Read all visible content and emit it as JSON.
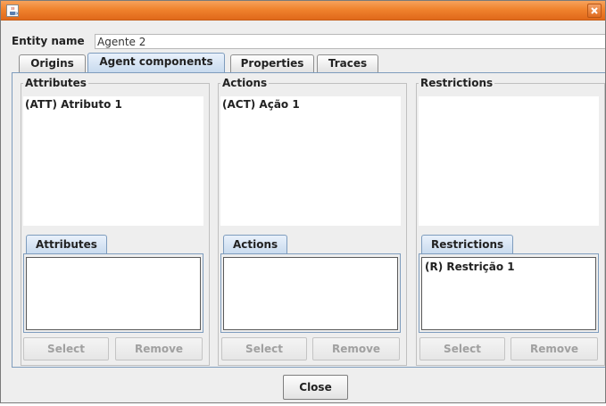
{
  "window": {
    "title": ""
  },
  "entity": {
    "label": "Entity name",
    "value": "Agente 2"
  },
  "tabs": [
    {
      "label": "Origins"
    },
    {
      "label": "Agent components"
    },
    {
      "label": "Properties"
    },
    {
      "label": "Traces"
    }
  ],
  "active_tab": "Agent components",
  "groups": [
    {
      "title": "Attributes",
      "items": [
        "(ATT) Atributo 1"
      ],
      "subtab": "Attributes",
      "sub_items": [
        ""
      ],
      "select_label": "Select",
      "remove_label": "Remove"
    },
    {
      "title": "Actions",
      "items": [
        "(ACT) Ação 1"
      ],
      "subtab": "Actions",
      "sub_items": [
        ""
      ],
      "select_label": "Select",
      "remove_label": "Remove"
    },
    {
      "title": "Restrictions",
      "items": [
        ""
      ],
      "subtab": "Restrictions",
      "sub_items": [
        "(R) Restrição 1"
      ],
      "select_label": "Select",
      "remove_label": "Remove"
    }
  ],
  "footer": {
    "close_label": "Close"
  },
  "colors": {
    "titlebar": "#f0832e",
    "accent_border": "#7e9cbd",
    "disabled_text": "#a0a0a0"
  },
  "icons": {
    "window_icon": "java-coffee-icon",
    "close": "close-icon"
  }
}
